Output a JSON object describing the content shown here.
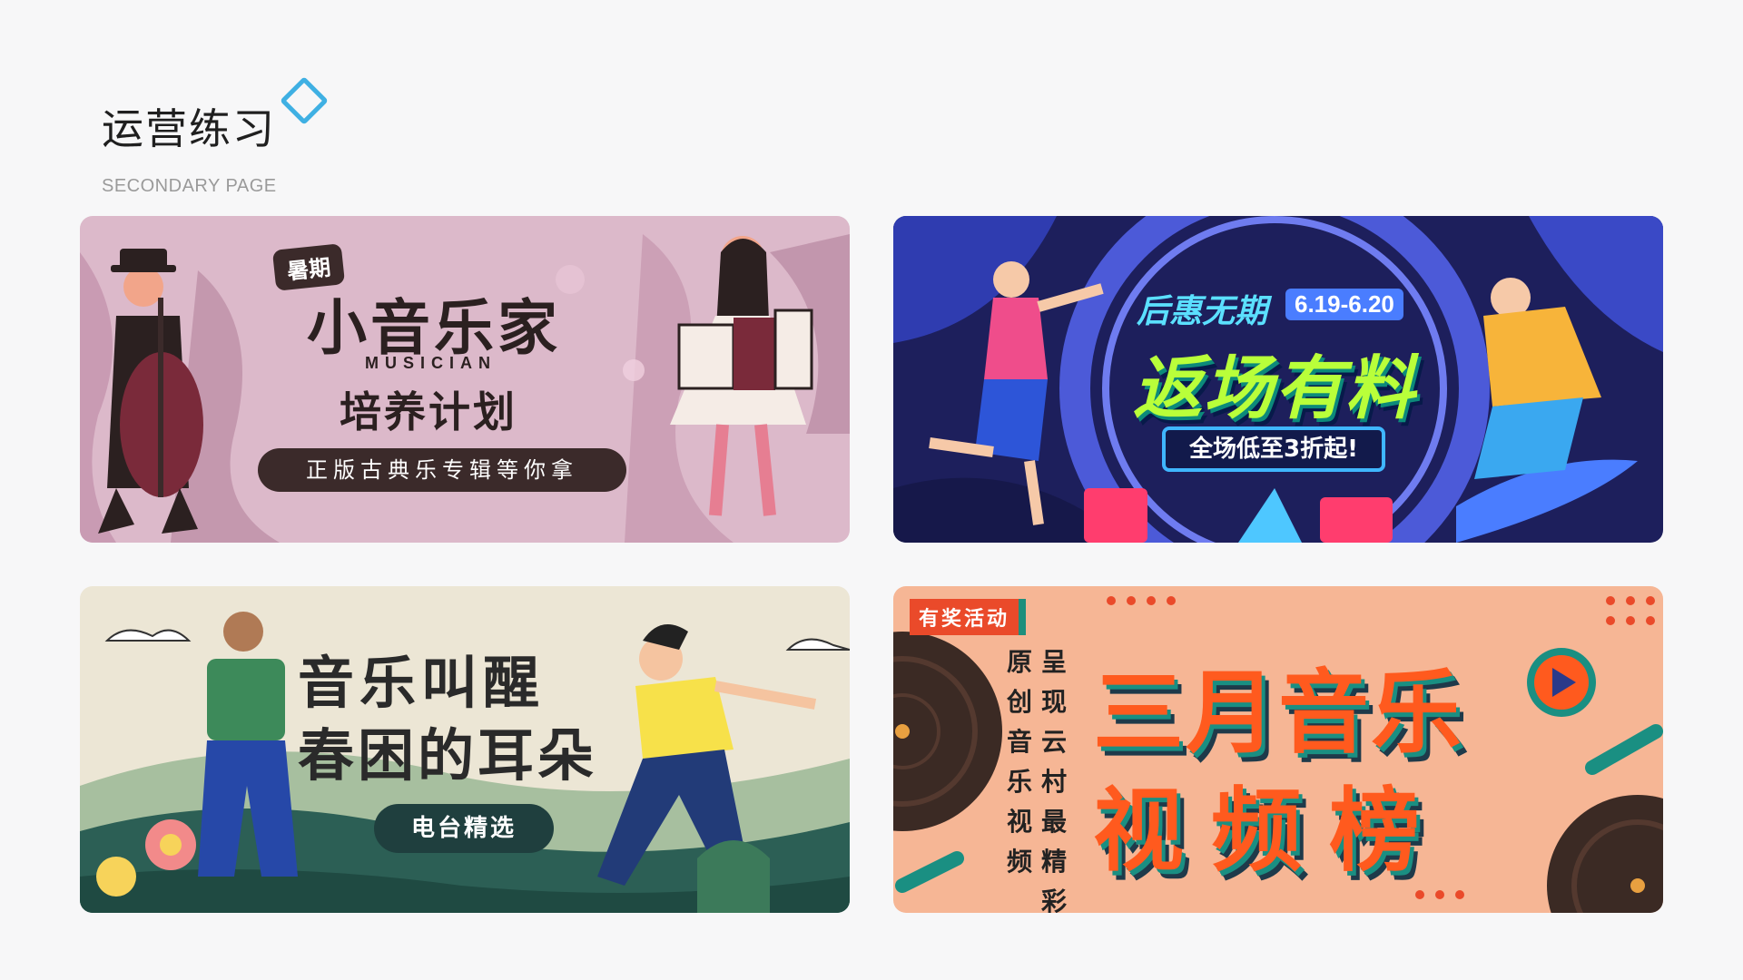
{
  "page": {
    "title": "运营练习",
    "subtitle": "SECONDARY PAGE"
  },
  "banners": [
    {
      "tag": "暑期",
      "title": "小音乐家",
      "subtitle_en": "MUSICIAN",
      "subtitle": "培养计划",
      "pill": "正版古典乐专辑等你拿"
    },
    {
      "headline": "后惠无期",
      "date": "6.19-6.20",
      "title": "返场有料",
      "pill": "全场低至3折起!"
    },
    {
      "title_line1": "音乐叫醒",
      "title_line2": "春困的耳朵",
      "pill": "电台精选"
    },
    {
      "tag": "有奖活动",
      "vertical_line1": "原创音乐视频",
      "vertical_line2": "呈现云村最精彩的",
      "title_line1": "三月音乐",
      "title_line2": "视频榜"
    }
  ],
  "colors": {
    "accent_diamond": "#3fb0e3",
    "banner1_bg": "#dcb9ca",
    "banner2_bg": "#1d1f5c",
    "banner3_bg": "#ece6d5",
    "banner4_bg": "#f6b695"
  }
}
